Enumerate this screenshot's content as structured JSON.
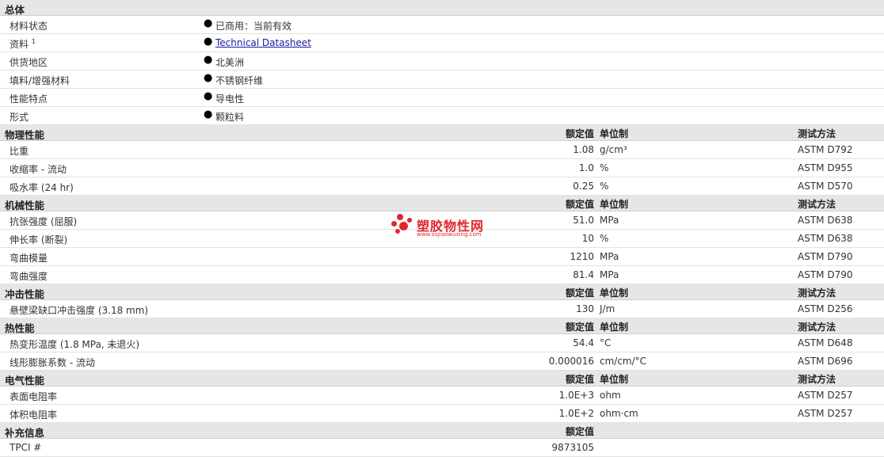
{
  "sections": {
    "general": {
      "title": "总体"
    },
    "physical": {
      "title": "物理性能"
    },
    "mechanical": {
      "title": "机械性能"
    },
    "impact": {
      "title": "冲击性能"
    },
    "thermal": {
      "title": "热性能"
    },
    "electrical": {
      "title": "电气性能"
    },
    "supplemental": {
      "title": "补充信息"
    }
  },
  "columns": {
    "nominal": "额定值",
    "unit": "单位制",
    "method": "测试方法"
  },
  "general": [
    {
      "label": "材料状态",
      "value": "已商用：当前有效"
    },
    {
      "label": "资料",
      "sup": "1",
      "value": "Technical Datasheet"
    },
    {
      "label": "供货地区",
      "value": "北美洲"
    },
    {
      "label": "填料/增强材料",
      "value": "不锈钢纤维"
    },
    {
      "label": "性能特点",
      "value": "导电性"
    },
    {
      "label": "形式",
      "value": "颗粒料"
    }
  ],
  "physical": [
    {
      "label": "比重",
      "value": "1.08",
      "unit": "g/cm³",
      "method": "ASTM D792"
    },
    {
      "label": "收缩率 - 流动",
      "value": "1.0",
      "unit": "%",
      "method": "ASTM D955"
    },
    {
      "label": "吸水率 (24 hr)",
      "value": "0.25",
      "unit": "%",
      "method": "ASTM D570"
    }
  ],
  "mechanical": [
    {
      "label": "抗张强度 (屈服)",
      "value": "51.0",
      "unit": "MPa",
      "method": "ASTM D638"
    },
    {
      "label": "伸长率 (断裂)",
      "value": "10",
      "unit": "%",
      "method": "ASTM D638"
    },
    {
      "label": "弯曲模量",
      "value": "1210",
      "unit": "MPa",
      "method": "ASTM D790"
    },
    {
      "label": "弯曲强度",
      "value": "81.4",
      "unit": "MPa",
      "method": "ASTM D790"
    }
  ],
  "impact": [
    {
      "label": "悬壁梁缺口冲击强度 (3.18 mm)",
      "value": "130",
      "unit": "J/m",
      "method": "ASTM D256"
    }
  ],
  "thermal": [
    {
      "label": "热变形温度 (1.8 MPa, 未退火)",
      "value": "54.4",
      "unit": "°C",
      "method": "ASTM D648"
    },
    {
      "label": "线形膨胀系数 - 流动",
      "value": "0.000016",
      "unit": "cm/cm/°C",
      "method": "ASTM D696"
    }
  ],
  "electrical": [
    {
      "label": "表面电阻率",
      "value": "1.0E+3",
      "unit": "ohm",
      "method": "ASTM D257"
    },
    {
      "label": "体积电阻率",
      "value": "1.0E+2",
      "unit": "ohm·cm",
      "method": "ASTM D257"
    }
  ],
  "supplemental": [
    {
      "label": "TPCI #",
      "value": "9873105"
    }
  ],
  "watermark": {
    "name": "塑胶物性网",
    "url": "www.sujiaowuxing.com"
  }
}
